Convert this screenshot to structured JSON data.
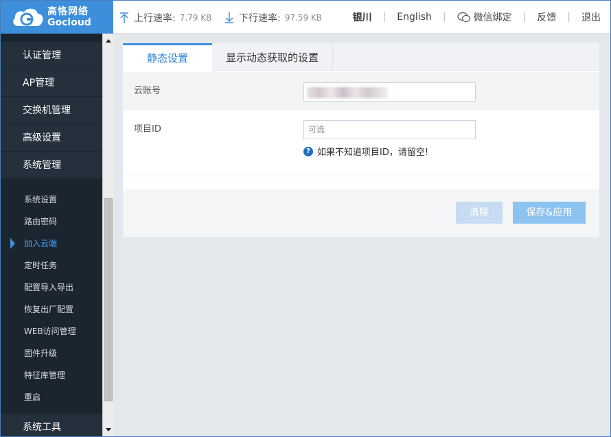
{
  "header": {
    "logo": {
      "cn": "高恪网络",
      "en": "Gocloud"
    },
    "upload": {
      "label": "上行速率:",
      "value": "7.79 KB"
    },
    "download": {
      "label": "下行速率:",
      "value": "97.59 KB"
    },
    "city": "银川",
    "language": "English",
    "wechat": "微信绑定",
    "feedback": "反馈",
    "logout": "退出"
  },
  "sidebar": {
    "main_items": [
      "认证管理",
      "AP管理",
      "交换机管理",
      "高级设置",
      "系统管理"
    ],
    "sub_items": [
      "系统设置",
      "路由密码",
      "加入云端",
      "定时任务",
      "配置导入导出",
      "恢复出厂配置",
      "WEB访问管理",
      "固件升级",
      "特征库管理",
      "重启"
    ],
    "active_sub": "加入云端",
    "bottom_item": "系统工具"
  },
  "tabs": {
    "active": "静态设置",
    "other": "显示动态获取的设置"
  },
  "form": {
    "cloud_account_label": "云账号",
    "project_id_label": "项目ID",
    "project_id_placeholder": "可选",
    "hint": "如果不知道项目ID，请留空!"
  },
  "buttons": {
    "clear": "清除",
    "save": "保存&应用"
  },
  "colors": {
    "brand": "#3d8fdc",
    "sidebar_bg": "#1b252f",
    "active_link": "#4aa3ff"
  }
}
